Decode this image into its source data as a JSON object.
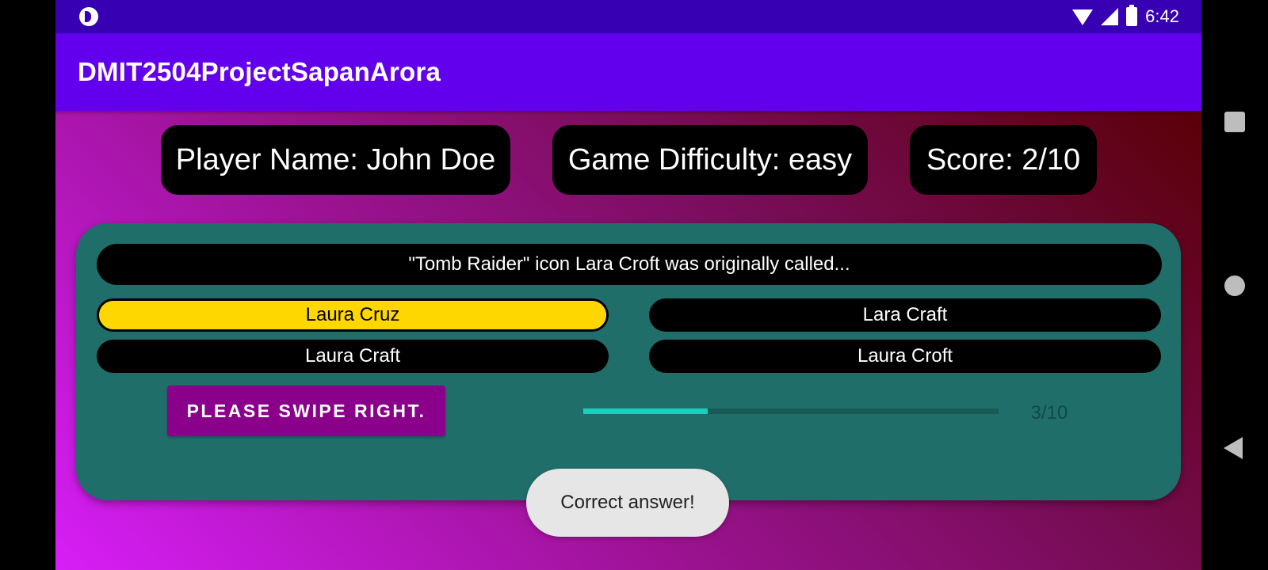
{
  "status_bar": {
    "left_icon": "notification-app-icon",
    "icons": [
      "wifi-icon",
      "signal-icon",
      "battery-charging-icon"
    ],
    "time": "6:42"
  },
  "app_bar": {
    "title": "DMIT2504ProjectSapanArora"
  },
  "header": {
    "player": "Player Name: John Doe",
    "difficulty": "Game Difficulty: easy",
    "score": "Score: 2/10"
  },
  "quiz": {
    "question": "\"Tomb Raider\" icon Lara Croft was originally called...",
    "answers": [
      {
        "label": "Laura Cruz",
        "selected": true
      },
      {
        "label": "Lara Craft",
        "selected": false
      },
      {
        "label": "Laura Craft",
        "selected": false
      },
      {
        "label": "Laura Croft",
        "selected": false
      }
    ],
    "swipe_button": "PLEASE SWIPE RIGHT.",
    "progress": {
      "value": 3,
      "max": 10,
      "label": "3/10"
    }
  },
  "toast": {
    "message": "Correct answer!"
  },
  "nav_bar": {
    "icons": [
      "recents-icon",
      "home-icon",
      "back-icon"
    ]
  },
  "colors": {
    "status_bar": "#3700b3",
    "app_bar": "#6200ee",
    "card": "#206e6a",
    "selected_answer": "#ffd700",
    "swipe_button": "#8b008b",
    "progress_fill": "#17d1be"
  }
}
